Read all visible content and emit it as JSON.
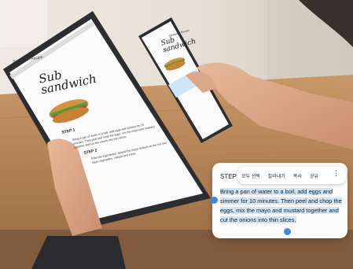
{
  "tablet": {
    "app_title": "Sandwich Recipe",
    "recipe_title": "Sub\nsandwich",
    "step1_heading": "STEP 1",
    "step1_text": "Bring a pan of water to a boil, add eggs and simmer for 10 minutes. Then peel and chop the eggs, mix the mayo and mustard together and cut the onions into thin slices.",
    "step2_heading": "STEP 2",
    "step2_text": "Fillet the ingredients, spread the mayo mixture on the roll and layer vegetables, cheese and meat."
  },
  "phone": {
    "app_title": "Sandwich Recipe",
    "recipe_title": "Sub\nsandwich"
  },
  "popup": {
    "step_label": "STEP 1",
    "menu": {
      "select_all": "모두 선택",
      "cut": "잘라내기",
      "copy": "복사",
      "share": "공유",
      "more": "⋮"
    },
    "selected_text": "Bring a pan of water to a boil, add eggs and simmer for 10 minutes. Then peel and chop the eggs, mix the mayo and mustard together and cut the onions into thin slices."
  },
  "colors": {
    "selection_highlight": "#cfe6f9",
    "selection_handle": "#3d8ae0",
    "table_wood": "#b8865a",
    "device_frame": "#2b2d30"
  }
}
